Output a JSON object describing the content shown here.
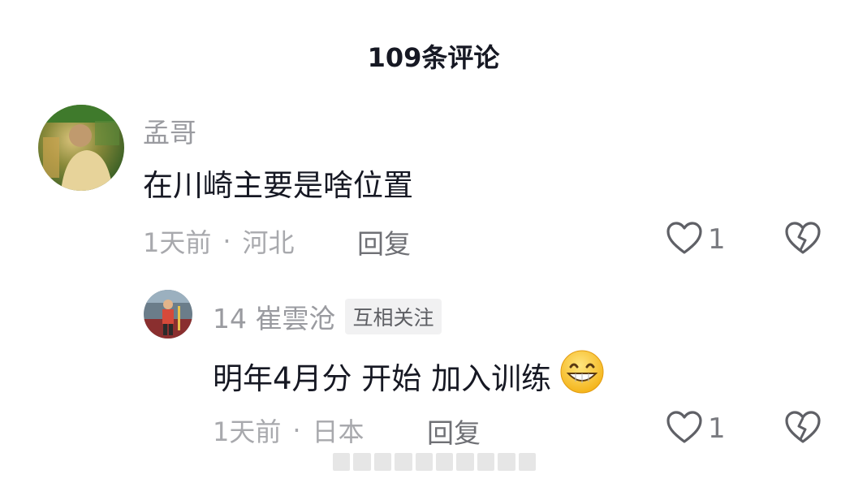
{
  "header": {
    "title": "109条评论"
  },
  "comments": [
    {
      "username": "孟哥",
      "text": "在川崎主要是啥位置",
      "time": "1天前",
      "location": "河北",
      "separator": "·",
      "reply_label": "回复",
      "likes": "1",
      "replies": [
        {
          "username": "14 崔雲沧",
          "badge": "互相关注",
          "text": "明年4月分 开始 加入训练",
          "time": "1天前",
          "location": "日本",
          "separator": "·",
          "reply_label": "回复",
          "likes": "1",
          "emoji": "grinning-face-emoji"
        }
      ]
    }
  ],
  "icons": {
    "like": "heart-outline-icon",
    "dislike": "broken-heart-icon"
  },
  "colors": {
    "text_primary": "#161823",
    "text_secondary": "#a8a9ad",
    "badge_bg": "#f1f1f2"
  }
}
